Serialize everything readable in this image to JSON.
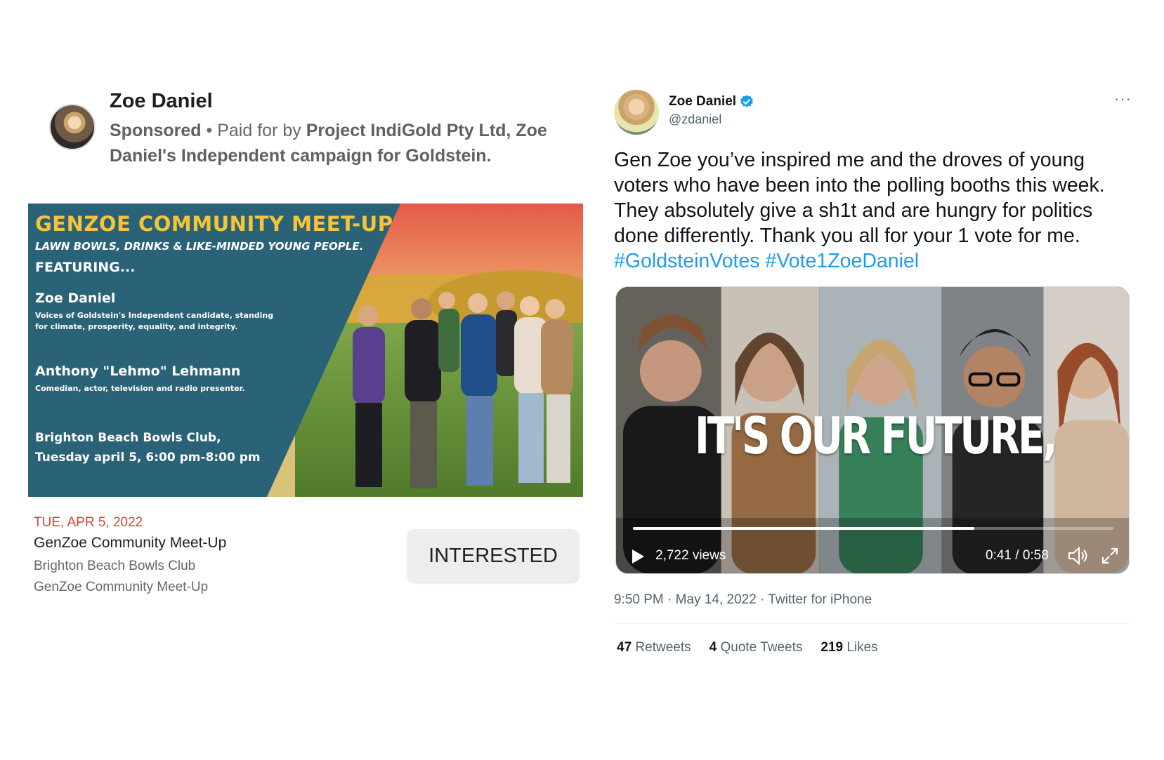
{
  "facebook_ad": {
    "page_name": "Zoe Daniel",
    "sponsored": "Sponsored",
    "paid_for_prefix": " • Paid for by ",
    "paid_for_by": "Project IndiGold Pty Ltd, Zoe Daniel's Independent campaign for Goldstein.",
    "image": {
      "headline": "GENZOE COMMUNITY MEET-UP",
      "subhead": "LAWN BOWLS, DRINKS & LIKE-MINDED YOUNG PEOPLE.",
      "featuring": "FEATURING...",
      "person1_name": "Zoe Daniel",
      "person1_desc": "Voices of Goldstein's Independent candidate, standing for climate, prosperity, equality, and integrity.",
      "person2_name": "Anthony \"Lehmo\" Lehmann",
      "person2_desc": "Comedian, actor, television and radio presenter.",
      "venue": "Brighton Beach Bowls Club,",
      "when": "Tuesday april 5, 6:00 pm-8:00 pm"
    },
    "event": {
      "date": "TUE, APR 5, 2022",
      "title": "GenZoe Community Meet-Up",
      "location": "Brighton Beach Bowls Club",
      "subtitle": "GenZoe Community Meet-Up",
      "button": "INTERESTED"
    }
  },
  "tweet": {
    "name": "Zoe Daniel",
    "handle": "@zdaniel",
    "more": "···",
    "body": "Gen Zoe you’ve inspired me and the droves of young voters who have been into the polling booths this week. They absolutely give a sh1t and are hungry for politics done differently. Thank you all for your 1 vote for me. ",
    "hashtags": "#GoldsteinVotes #Vote1ZoeDaniel",
    "video": {
      "caption": "IT'S OUR FUTURE,",
      "views": "2,722 views",
      "time": "0:41 / 0:58",
      "progress": 0.71
    },
    "meta": "9:50 PM · May 14, 2022 · Twitter for iPhone",
    "stats": {
      "retweets_count": "47",
      "retweets_label": " Retweets",
      "quotes_count": "4",
      "quotes_label": " Quote Tweets",
      "likes_count": "219",
      "likes_label": " Likes"
    },
    "colors": {
      "link": "#1d9bf0",
      "verified": "#1d9bf0"
    }
  }
}
